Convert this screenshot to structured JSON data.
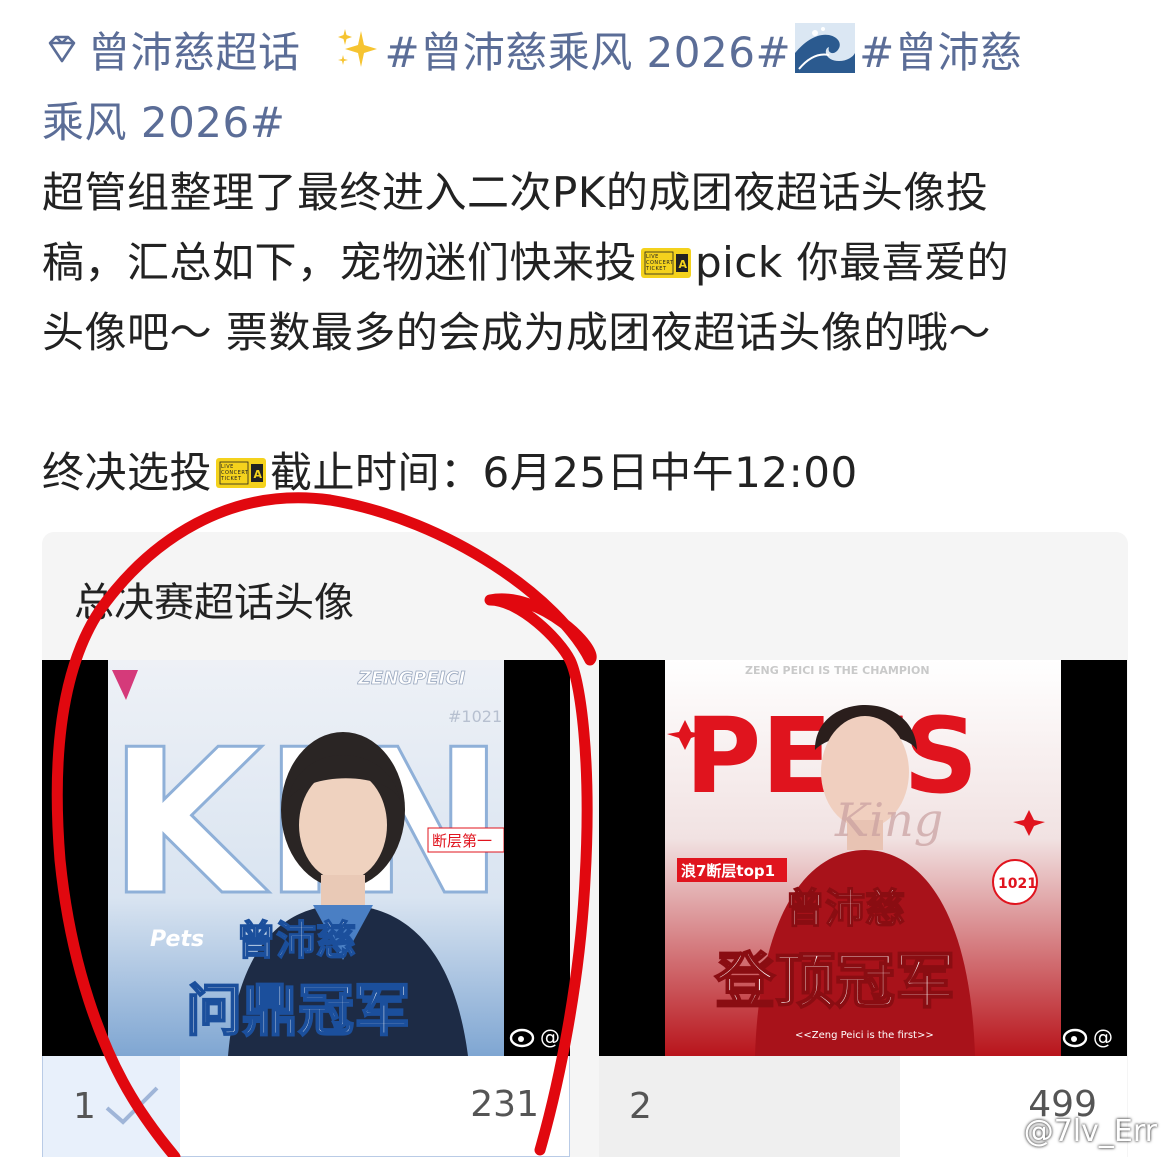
{
  "post": {
    "topic_name": "曾沛慈超话",
    "hashtag_1": "#曾沛慈乘风 2026#",
    "hashtag_2_part1": "#曾沛慈",
    "hashtag_2_part2": "乘风 2026#",
    "body_line_1": "超管组整理了最终进入二次PK的成团夜超话头像投",
    "body_line_2_a": "稿，汇总如下，宠物迷们快来投",
    "body_line_2_b": "pick 你最喜爱的",
    "body_line_3": "头像吧～ 票数最多的会成为成团夜超话头像的哦～",
    "deadline_a": "终决选投",
    "deadline_b": "截止时间：6月25日中午12:00",
    "icons": {
      "topic": "diamond-icon",
      "sparkles": "sparkles-emoji",
      "wave": "wave-emoji",
      "ticket": "ticket-emoji"
    },
    "link_color": "#5b6d97"
  },
  "vote": {
    "title": "总决赛超话头像",
    "options": [
      {
        "index": "1",
        "count": "231",
        "selected": true,
        "share": 0.26,
        "poster": {
          "brand": "ZENGPEICI",
          "number": "#1021",
          "big_letters": "KING",
          "side_tag": "断层第一",
          "name": "曾沛慈",
          "caption": "问鼎冠军",
          "script": "Pets"
        }
      },
      {
        "index": "2",
        "count": "499",
        "selected": false,
        "share": 0.57,
        "poster": {
          "header": "ZENG PEICI IS THE CHAMPION",
          "big": "PETS",
          "script": "King",
          "tag": "浪7断层top1",
          "badge": "1021",
          "name": "曾沛慈",
          "caption": "登顶冠军",
          "footer": "<<Zeng Peici is the first>>"
        }
      }
    ]
  },
  "watermark": "@7lv_Err",
  "colors": {
    "accent_red": "#e0141e",
    "fill_selected": "#e8f0fb",
    "border_selected": "#b9cbe6"
  }
}
